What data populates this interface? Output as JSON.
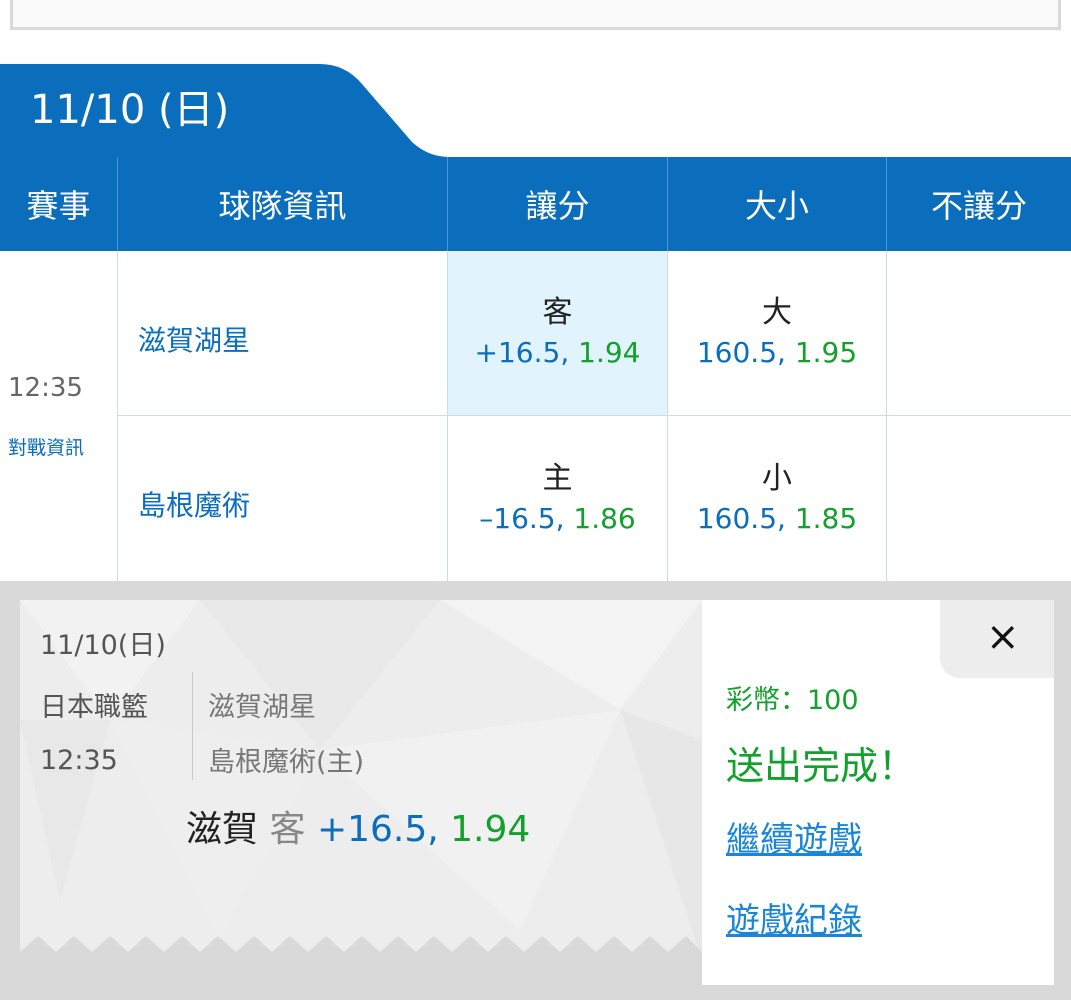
{
  "date_tab": "11/10 (日)",
  "colors": {
    "header_blue": "#0a6ebd",
    "odds_green": "#13a02c",
    "highlight": "#e1f3fc"
  },
  "table": {
    "headers": {
      "event": "賽事",
      "team": "球隊資訊",
      "spread": "讓分",
      "over_under": "大小",
      "moneyline": "不讓分"
    },
    "event_time": "12:35",
    "event_link": "對戰資訊",
    "rows": [
      {
        "team": "滋賀湖星",
        "spread_side": "客",
        "spread_line": "+16.5,",
        "spread_odds": "1.94",
        "ou_side": "大",
        "ou_line": "160.5,",
        "ou_odds": "1.95"
      },
      {
        "team": "島根魔術",
        "spread_side": "主",
        "spread_line": "–16.5,",
        "spread_odds": "1.86",
        "ou_side": "小",
        "ou_line": "160.5,",
        "ou_odds": "1.85"
      }
    ]
  },
  "slip": {
    "date": "11/10(日)",
    "league": "日本職籃",
    "time": "12:35",
    "away_team": "滋賀湖星",
    "home_team": "島根魔術(主)",
    "bet_team": "滋賀",
    "bet_side": "客",
    "bet_line": "+16.5,",
    "bet_odds": "1.94",
    "coins": "彩幣：100",
    "status": "送出完成！",
    "continue_link": "繼續遊戲",
    "record_link": "遊戲紀錄",
    "close_icon": "×"
  }
}
